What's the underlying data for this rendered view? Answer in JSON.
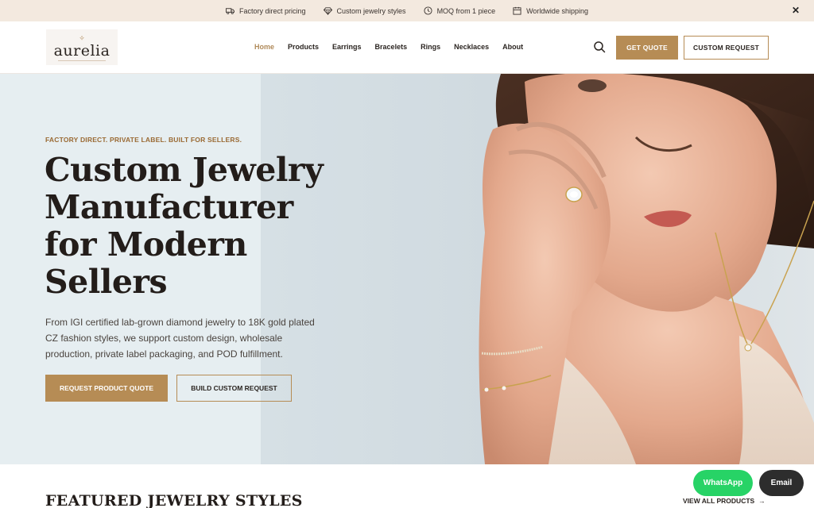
{
  "topbar": {
    "items": [
      {
        "icon": "truck-icon",
        "label": "Factory direct pricing"
      },
      {
        "icon": "diamond-icon",
        "label": "Custom jewelry styles"
      },
      {
        "icon": "clock-icon",
        "label": "MOQ from 1 piece"
      },
      {
        "icon": "calendar-icon",
        "label": "Worldwide shipping"
      }
    ],
    "close_label": "✕"
  },
  "header": {
    "logo_text": "aurelia",
    "logo_mark": "✧",
    "nav": [
      {
        "label": "Home",
        "active": true
      },
      {
        "label": "Products"
      },
      {
        "label": "Earrings"
      },
      {
        "label": "Bracelets"
      },
      {
        "label": "Rings"
      },
      {
        "label": "Necklaces"
      },
      {
        "label": "About"
      }
    ],
    "get_quote": "GET QUOTE",
    "custom_request": "CUSTOM REQUEST"
  },
  "hero": {
    "eyebrow": "FACTORY DIRECT. PRIVATE LABEL. BUILT FOR SELLERS.",
    "title_lines": [
      "Custom Jewelry",
      "Manufacturer",
      "for Modern",
      "Sellers"
    ],
    "description": "From IGI certified lab-grown diamond jewelry to 18K gold plated CZ fashion styles, we support custom design, wholesale production, private label packaging, and POD fulfillment.",
    "primary_cta": "REQUEST PRODUCT QUOTE",
    "secondary_cta": "BUILD CUSTOM REQUEST"
  },
  "featured": {
    "title": "FEATURED JEWELRY STYLES",
    "view_all": "VIEW ALL PRODUCTS",
    "view_all_arrow": "→"
  },
  "contact": {
    "whatsapp": "WhatsApp",
    "email": "Email"
  },
  "colors": {
    "accent": "#b68c55",
    "topbar_bg": "#f3e9df",
    "whatsapp": "#27d366",
    "email_bg": "#2d2d2d"
  }
}
